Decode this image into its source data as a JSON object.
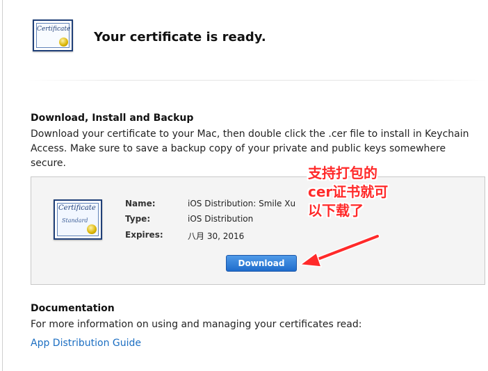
{
  "header": {
    "title": "Your certificate is ready.",
    "icon_text": "Certificate"
  },
  "download_section": {
    "title": "Download, Install and Backup",
    "description_line1": "Download your certificate to your Mac, then double click the .cer file to install in Keychain",
    "description_line2": "Access. Make sure to save a backup copy of your private and public keys somewhere secure."
  },
  "certificate": {
    "icon_text_main": "Certificate",
    "icon_text_sub": "Standard",
    "fields": [
      {
        "label": "Name:",
        "value": "iOS Distribution: Smile Xu"
      },
      {
        "label": "Type:",
        "value": "iOS Distribution"
      },
      {
        "label": "Expires:",
        "value": "八月 30, 2016"
      }
    ],
    "download_label": "Download"
  },
  "annotation": {
    "line1": "支持打包的",
    "line2": "cer证书就可",
    "line3": "以下载了",
    "color": "#ff2a2a"
  },
  "documentation": {
    "title": "Documentation",
    "description": "For more information on using and managing your certificates read:",
    "link_label": "App Distribution Guide"
  },
  "colors": {
    "link": "#1b6ec2",
    "button": "#1f6ccc"
  }
}
